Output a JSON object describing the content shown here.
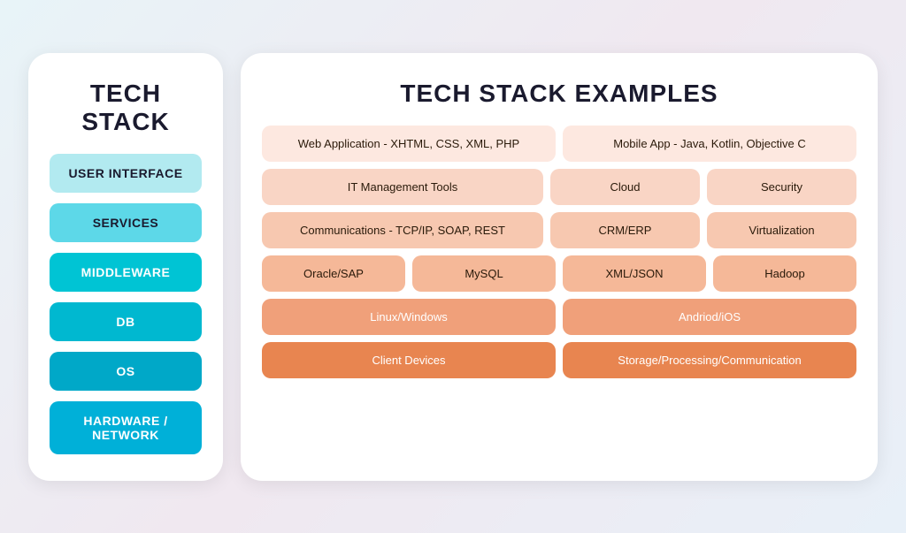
{
  "leftPanel": {
    "title": "TECH STACK",
    "items": [
      {
        "label": "USER INTERFACE",
        "colorClass": "stack-user-interface"
      },
      {
        "label": "SERVICES",
        "colorClass": "stack-services"
      },
      {
        "label": "MIDDLEWARE",
        "colorClass": "stack-middleware"
      },
      {
        "label": "DB",
        "colorClass": "stack-db"
      },
      {
        "label": "OS",
        "colorClass": "stack-os"
      },
      {
        "label": "HARDWARE / NETWORK",
        "colorClass": "stack-hardware"
      }
    ]
  },
  "rightPanel": {
    "title": "TECH STACK EXAMPLES",
    "rows": [
      {
        "colorClass": "row-1",
        "cells": [
          {
            "label": "Web Application - XHTML, CSS, XML, PHP",
            "flex": "flex-1"
          },
          {
            "label": "Mobile App - Java, Kotlin, Objective C",
            "flex": "flex-1"
          }
        ]
      },
      {
        "colorClass": "row-2",
        "cells": [
          {
            "label": "IT Management Tools",
            "flex": "flex-2"
          },
          {
            "label": "Cloud",
            "flex": "flex-1"
          },
          {
            "label": "Security",
            "flex": "flex-1"
          }
        ]
      },
      {
        "colorClass": "row-3",
        "cells": [
          {
            "label": "Communications - TCP/IP, SOAP, REST",
            "flex": "flex-2"
          },
          {
            "label": "CRM/ERP",
            "flex": "flex-1"
          },
          {
            "label": "Virtualization",
            "flex": "flex-1"
          }
        ]
      },
      {
        "colorClass": "row-4",
        "cells": [
          {
            "label": "Oracle/SAP",
            "flex": "flex-1"
          },
          {
            "label": "MySQL",
            "flex": "flex-1"
          },
          {
            "label": "XML/JSON",
            "flex": "flex-1"
          },
          {
            "label": "Hadoop",
            "flex": "flex-1"
          }
        ]
      },
      {
        "colorClass": "row-5",
        "cells": [
          {
            "label": "Linux/Windows",
            "flex": "flex-1"
          },
          {
            "label": "Andriod/iOS",
            "flex": "flex-1"
          }
        ]
      },
      {
        "colorClass": "row-6",
        "cells": [
          {
            "label": "Client Devices",
            "flex": "flex-1"
          },
          {
            "label": "Storage/Processing/Communication",
            "flex": "flex-1"
          }
        ]
      }
    ]
  }
}
